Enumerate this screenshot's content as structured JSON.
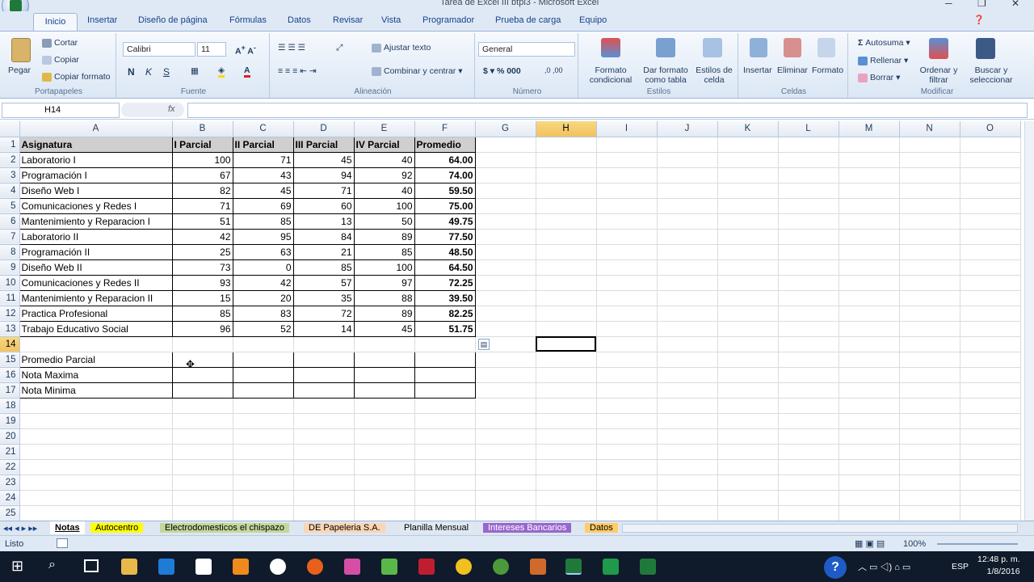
{
  "window": {
    "title": "Tarea de Excel III btpi3 - Microsoft Excel"
  },
  "tabs": [
    "Inicio",
    "Insertar",
    "Diseño de página",
    "Fórmulas",
    "Datos",
    "Revisar",
    "Vista",
    "Programador",
    "Prueba de carga",
    "Equipo"
  ],
  "ribbon": {
    "portapapeles": {
      "label": "Portapapeles",
      "pegar": "Pegar",
      "cortar": "Cortar",
      "copiar": "Copiar",
      "copiar_formato": "Copiar formato"
    },
    "fuente": {
      "label": "Fuente",
      "font": "Calibri",
      "size": "11"
    },
    "alineacion": {
      "label": "Alineación",
      "ajustar": "Ajustar texto",
      "combinar": "Combinar y centrar"
    },
    "numero": {
      "label": "Número",
      "format": "General"
    },
    "estilos": {
      "label": "Estilos",
      "formato_condicional": "Formato condicional",
      "dar_formato": "Dar formato como tabla",
      "estilos_celda": "Estilos de celda"
    },
    "celdas": {
      "label": "Celdas",
      "insertar": "Insertar",
      "eliminar": "Eliminar",
      "formato": "Formato"
    },
    "modificar": {
      "label": "Modificar",
      "autosuma": "Autosuma",
      "rellenar": "Rellenar",
      "borrar": "Borrar",
      "ordenar": "Ordenar y filtrar",
      "buscar": "Buscar y seleccionar"
    }
  },
  "formula_bar": {
    "name_box": "H14",
    "fx": "fx",
    "content": ""
  },
  "columns": [
    "A",
    "B",
    "C",
    "D",
    "E",
    "F",
    "G",
    "H",
    "I",
    "J",
    "K",
    "L",
    "M",
    "N",
    "O"
  ],
  "header_row": [
    "Asignatura",
    "I Parcial",
    "II Parcial",
    "III Parcial",
    "IV Parcial",
    "Promedio"
  ],
  "rows": [
    {
      "name": "Laboratorio I",
      "v": [
        "100",
        "71",
        "45",
        "40"
      ],
      "avg": "64.00"
    },
    {
      "name": "Programación I",
      "v": [
        "67",
        "43",
        "94",
        "92"
      ],
      "avg": "74.00"
    },
    {
      "name": "Diseño Web I",
      "v": [
        "82",
        "45",
        "71",
        "40"
      ],
      "avg": "59.50"
    },
    {
      "name": "Comunicaciones y Redes I",
      "v": [
        "71",
        "69",
        "60",
        "100"
      ],
      "avg": "75.00"
    },
    {
      "name": "Mantenimiento y Reparacion I",
      "v": [
        "51",
        "85",
        "13",
        "50"
      ],
      "avg": "49.75"
    },
    {
      "name": "Laboratorio II",
      "v": [
        "42",
        "95",
        "84",
        "89"
      ],
      "avg": "77.50"
    },
    {
      "name": "Programación II",
      "v": [
        "25",
        "63",
        "21",
        "85"
      ],
      "avg": "48.50"
    },
    {
      "name": "Diseño Web II",
      "v": [
        "73",
        "0",
        "85",
        "100"
      ],
      "avg": "64.50"
    },
    {
      "name": "Comunicaciones y Redes II",
      "v": [
        "93",
        "42",
        "57",
        "97"
      ],
      "avg": "72.25"
    },
    {
      "name": "Mantenimiento y Reparacion II",
      "v": [
        "15",
        "20",
        "35",
        "88"
      ],
      "avg": "39.50"
    },
    {
      "name": "Practica Profesional",
      "v": [
        "85",
        "83",
        "72",
        "89"
      ],
      "avg": "82.25"
    },
    {
      "name": "Trabajo Educativo Social",
      "v": [
        "96",
        "52",
        "14",
        "45"
      ],
      "avg": "51.75"
    }
  ],
  "summary_rows": [
    "Promedio Parcial",
    "Nota Maxima",
    "Nota Minima"
  ],
  "sheet_tabs": [
    "Notas",
    "Autocentro",
    "Electrodomesticos el chispazo",
    "DE Papeleria S.A.",
    "Planilla Mensual",
    "Intereses Bancarios",
    "Datos"
  ],
  "status": {
    "mode": "Listo",
    "zoom": "100%"
  },
  "taskbar": {
    "lang": "ESP",
    "time": "12:48 p. m.",
    "date": "1/8/2016"
  }
}
